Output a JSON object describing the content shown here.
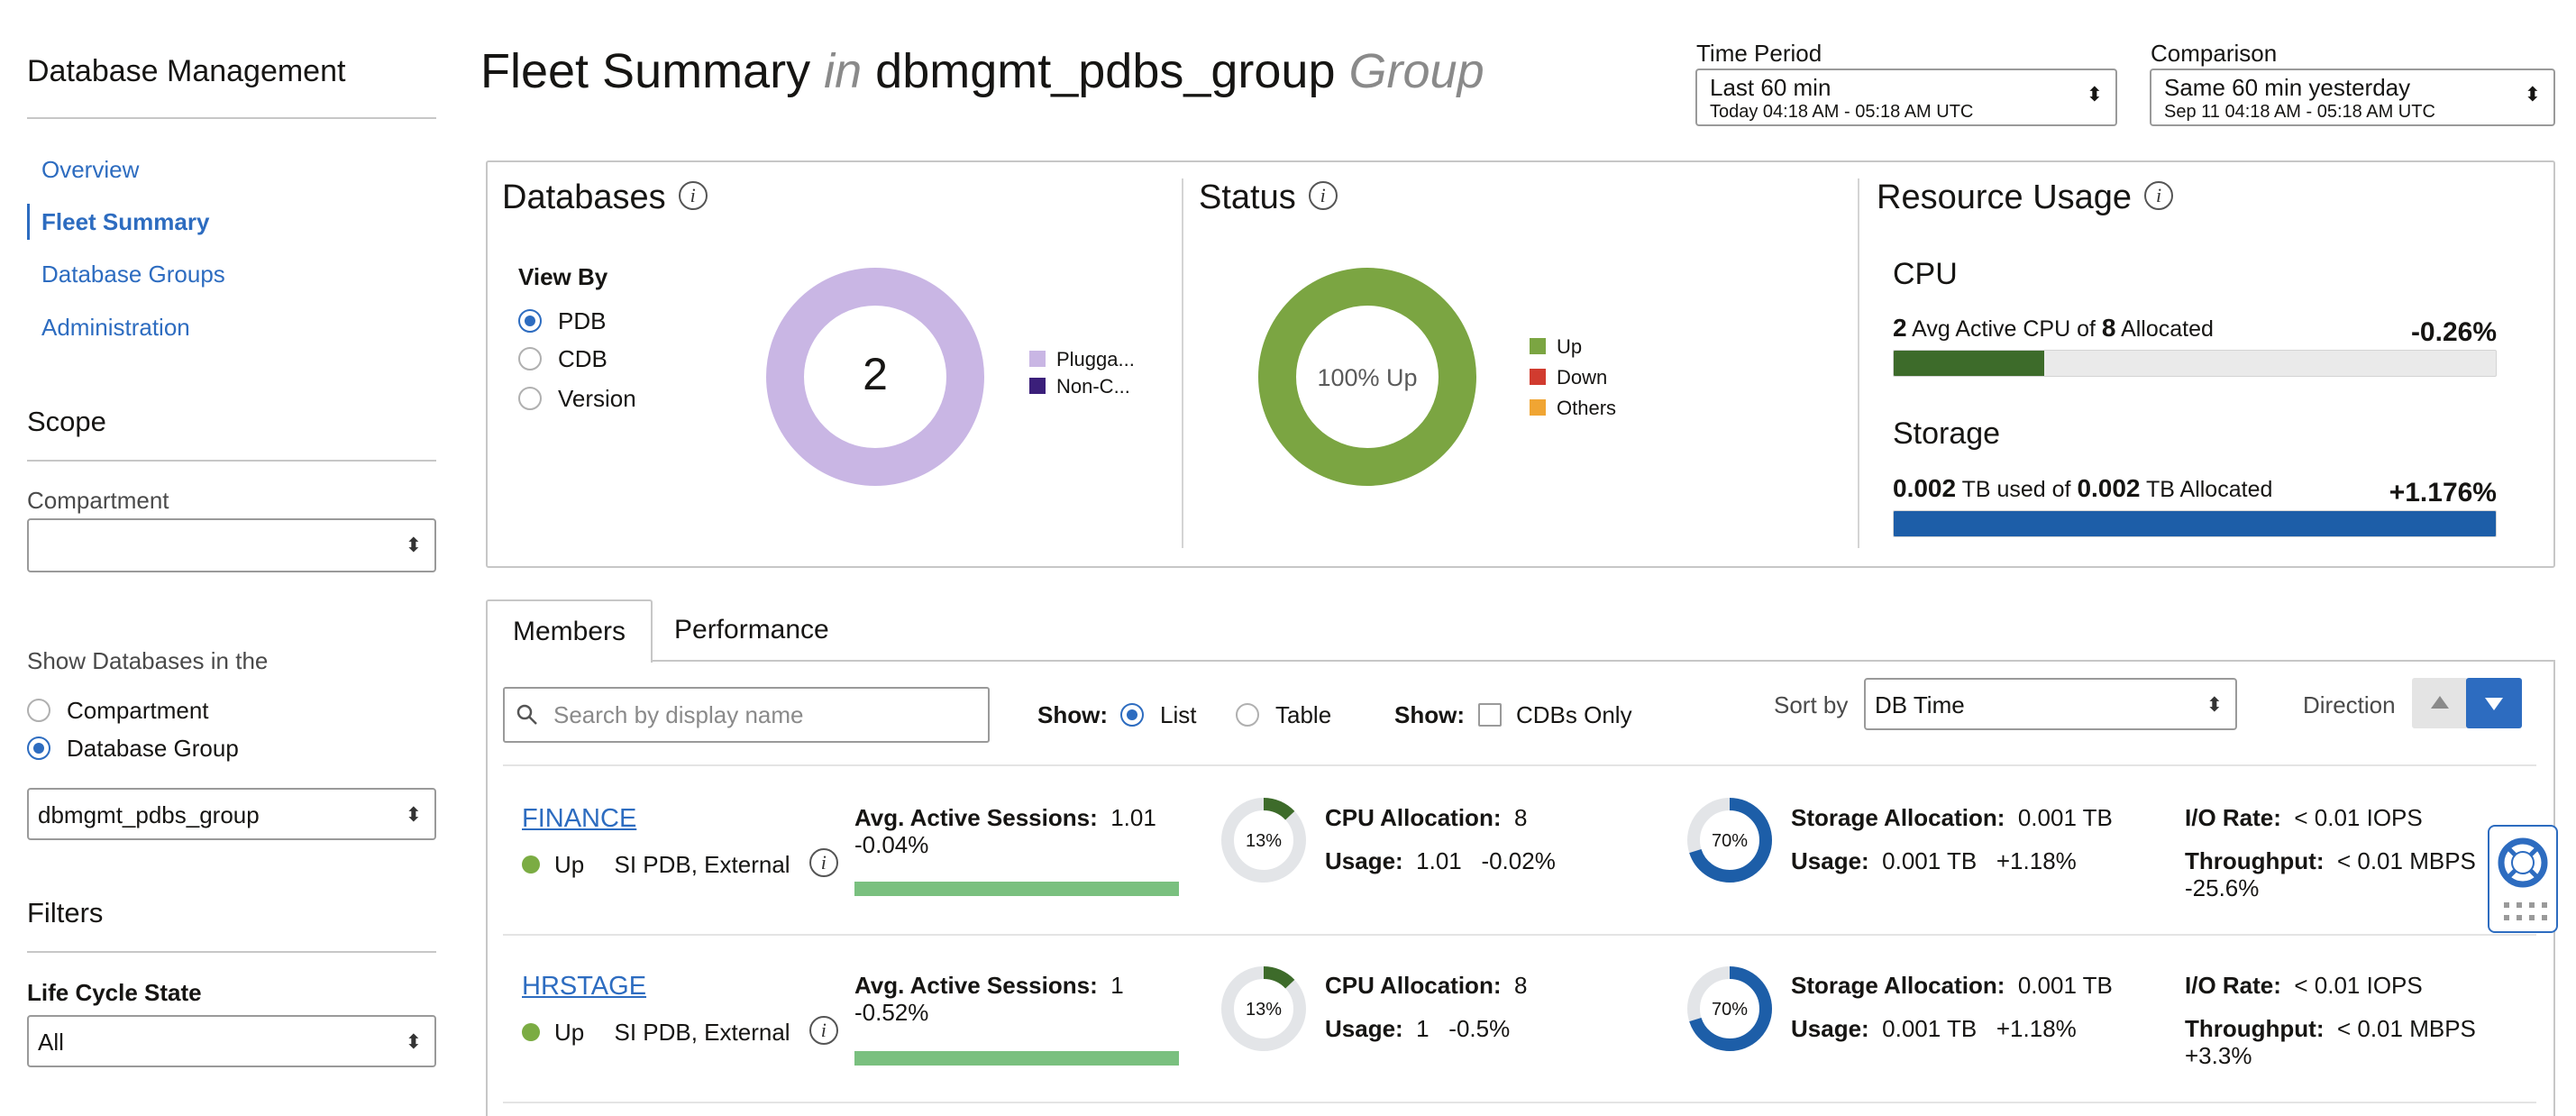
{
  "sidebar": {
    "title": "Database Management",
    "nav": [
      {
        "label": "Overview"
      },
      {
        "label": "Fleet Summary"
      },
      {
        "label": "Database Groups"
      },
      {
        "label": "Administration"
      }
    ],
    "scope_title": "Scope",
    "compartment_label": "Compartment",
    "compartment_value": "",
    "show_db_label": "Show Databases in the",
    "show_db_options": [
      {
        "label": "Compartment",
        "selected": false
      },
      {
        "label": "Database Group",
        "selected": true
      }
    ],
    "group_value": "dbmgmt_pdbs_group",
    "filters_title": "Filters",
    "lifecycle_label": "Life Cycle State",
    "lifecycle_value": "All"
  },
  "header": {
    "title_main": "Fleet Summary",
    "title_in": "in",
    "title_group": "dbmgmt_pdbs_group",
    "title_suffix": "Group",
    "time_period_label": "Time Period",
    "time_period_value": "Last 60 min",
    "time_period_sub": "Today 04:18 AM - 05:18 AM UTC",
    "comparison_label": "Comparison",
    "comparison_value": "Same 60 min yesterday",
    "comparison_sub": "Sep 11 04:18 AM - 05:18 AM UTC"
  },
  "databases": {
    "title": "Databases",
    "view_by_label": "View By",
    "view_by_options": [
      {
        "label": "PDB",
        "selected": true
      },
      {
        "label": "CDB",
        "selected": false
      },
      {
        "label": "Version",
        "selected": false
      }
    ],
    "count": "2",
    "legend": [
      {
        "label": "Plugga...",
        "color": "#c9b6e4"
      },
      {
        "label": "Non-C...",
        "color": "#3b1f7a"
      }
    ]
  },
  "status": {
    "title": "Status",
    "center_label": "100% Up",
    "up_fraction": 1.0,
    "legend": [
      {
        "label": "Up",
        "color": "#7ba542"
      },
      {
        "label": "Down",
        "color": "#d13b2f"
      },
      {
        "label": "Others",
        "color": "#f0a533"
      }
    ]
  },
  "resource": {
    "title": "Resource Usage",
    "cpu": {
      "heading": "CPU",
      "used": "2",
      "used_text": "Avg Active CPU of",
      "allocated": "8",
      "allocated_text": "Allocated",
      "change": "-0.26%",
      "fill_fraction": 0.25,
      "color": "#3d6b2a"
    },
    "storage": {
      "heading": "Storage",
      "used": "0.002",
      "used_text": "TB used of",
      "allocated": "0.002",
      "allocated_text": "TB Allocated",
      "change": "+1.176%",
      "fill_fraction": 1.0,
      "color": "#1d5ea8"
    }
  },
  "tabs": [
    {
      "label": "Members",
      "active": true
    },
    {
      "label": "Performance",
      "active": false
    }
  ],
  "toolbar": {
    "search_placeholder": "Search by display name",
    "show_label": "Show:",
    "list_label": "List",
    "table_label": "Table",
    "show2_label": "Show:",
    "cdbs_only_label": "CDBs Only",
    "sort_by_label": "Sort by",
    "sort_by_value": "DB Time",
    "direction_label": "Direction"
  },
  "members": [
    {
      "name": "FINANCE",
      "status": "Up",
      "type": "SI PDB, External",
      "aas_label": "Avg. Active Sessions:",
      "aas_value": "1.01",
      "aas_change": "-0.04%",
      "cpu_pct": "13%",
      "cpu_fraction": 0.13,
      "cpu_alloc_label": "CPU Allocation:",
      "cpu_alloc_value": "8",
      "cpu_usage_label": "Usage:",
      "cpu_usage_value": "1.01",
      "cpu_usage_change": "-0.02%",
      "storage_pct": "70%",
      "storage_fraction": 0.7,
      "storage_alloc_label": "Storage Allocation:",
      "storage_alloc_value": "0.001 TB",
      "storage_usage_label": "Usage:",
      "storage_usage_value": "0.001 TB",
      "storage_usage_change": "+1.18%",
      "io_label": "I/O Rate:",
      "io_value": "< 0.01 IOPS",
      "tp_label": "Throughput:",
      "tp_value": "< 0.01 MBPS",
      "tp_change": "-25.6%"
    },
    {
      "name": "HRSTAGE",
      "status": "Up",
      "type": "SI PDB, External",
      "aas_label": "Avg. Active Sessions:",
      "aas_value": "1",
      "aas_change": "-0.52%",
      "cpu_pct": "13%",
      "cpu_fraction": 0.13,
      "cpu_alloc_label": "CPU Allocation:",
      "cpu_alloc_value": "8",
      "cpu_usage_label": "Usage:",
      "cpu_usage_value": "1",
      "cpu_usage_change": "-0.5%",
      "storage_pct": "70%",
      "storage_fraction": 0.7,
      "storage_alloc_label": "Storage Allocation:",
      "storage_alloc_value": "0.001 TB",
      "storage_usage_label": "Usage:",
      "storage_usage_value": "0.001 TB",
      "storage_usage_change": "+1.18%",
      "io_label": "I/O Rate:",
      "io_value": "< 0.01 IOPS",
      "tp_label": "Throughput:",
      "tp_value": "< 0.01 MBPS",
      "tp_change": "+3.3%"
    }
  ],
  "colors": {
    "link": "#2d6cc0",
    "cpu_ring": "#3d6b2a",
    "storage_ring": "#1d5ea8",
    "ring_track": "#e3e5e8",
    "db_donut": "#c9b6e4",
    "status_donut": "#7ba542"
  }
}
